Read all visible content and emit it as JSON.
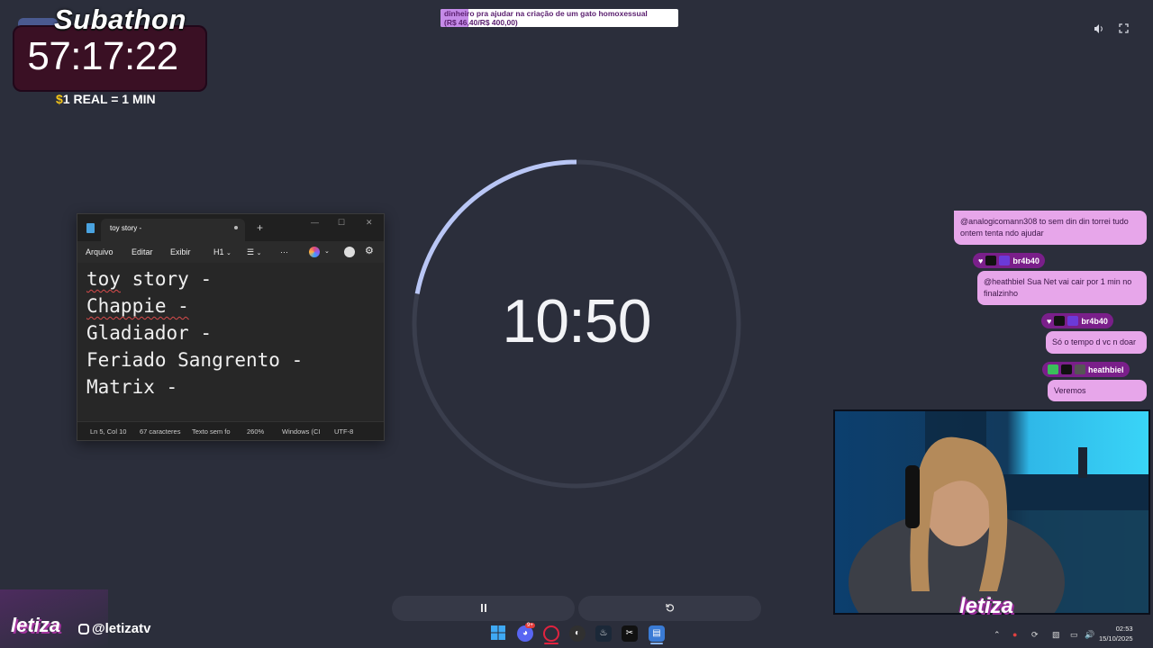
{
  "subathon": {
    "title": "Subathon",
    "time": "57:17:22",
    "rate_symbol": "$",
    "rate": "1 REAL = 1 MIN"
  },
  "donation_goal": {
    "text_line1": "dinheiro pra ajudar na criação de um gato homoxessual",
    "text_line2": "(R$ 46,40/R$ 400,00)",
    "progress": 0.116
  },
  "timer": {
    "display": "10:50",
    "remaining_fraction": 0.22,
    "pause_icon": "pause-icon",
    "reset_icon": "reset-icon"
  },
  "notepad": {
    "tab_title": "toy story -",
    "menu": [
      "Arquivo",
      "Editar",
      "Exibir",
      "H1"
    ],
    "lines": [
      "toy story -",
      "Chappie -",
      "Gladiador -",
      "Feriado Sangrento -",
      "Matrix -"
    ],
    "status": {
      "position": "Ln 5, Col 10",
      "chars": "67 caracteres",
      "format": "Texto sem fo",
      "zoom": "260%",
      "line_ending": "Windows (CI",
      "encoding": "UTF-8"
    }
  },
  "chat": [
    {
      "user": "",
      "message": "@analogicomann308 to sem din din torrei tudo ontem tenta ndo ajudar"
    },
    {
      "user": "br4b40",
      "message": "@heathbiel Sua Net vai cair por 1 min no finalzinho"
    },
    {
      "user": "br4b40",
      "message": "Só o tempo d vc n doar"
    },
    {
      "user": "heathbiel",
      "message": "Veremos"
    }
  ],
  "branding": {
    "logo": "letiza",
    "instagram": "@letizatv",
    "cam_logo": "letiza"
  },
  "taskbar": {
    "time": "02:53",
    "date": "15/10/2025",
    "discord_badge": "9+"
  },
  "colors": {
    "background": "#2b2e3b",
    "timer_arc": "#b9c6f5",
    "timer_track": "#3a3e4d",
    "chat_bubble": "#e7a6ea",
    "goal_fill": "#c58be8"
  }
}
